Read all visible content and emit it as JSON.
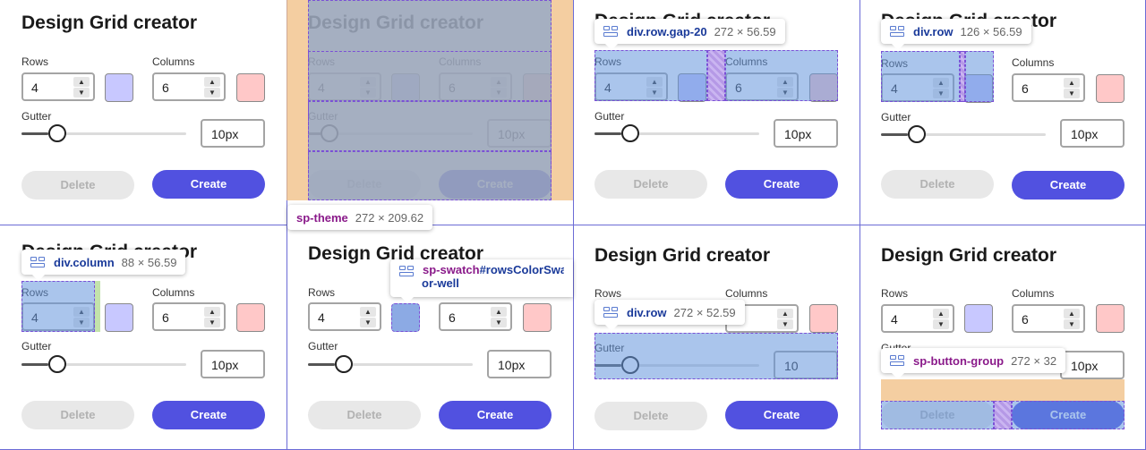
{
  "app": {
    "title": "Design Grid creator",
    "rows_label": "Rows",
    "columns_label": "Columns",
    "gutter_label": "Gutter",
    "rows_value": "4",
    "columns_value": "6",
    "gutter_value": "10px",
    "gutter_value_alt": "10",
    "delete_label": "Delete",
    "create_label": "Create",
    "rows_swatch_color": "#c8c8ff",
    "columns_swatch_color": "#ffc8c8"
  },
  "tooltips": {
    "p2": {
      "name": "sp-theme",
      "dims": "272 × 209.62"
    },
    "p3": {
      "name": "div.row.gap-20",
      "dims": "272 × 56.59"
    },
    "p4": {
      "name": "div.row",
      "dims": "126 × 56.59"
    },
    "p5": {
      "name": "div.column",
      "dims": "88 × 56.59"
    },
    "p6": {
      "name": "sp-swatch",
      "name_suffix": "#rowsColorSwatch",
      "line2": "or-well"
    },
    "p7": {
      "name": "div.row",
      "dims": "272 × 52.59"
    },
    "p8": {
      "name": "sp-button-group",
      "dims": "272 × 32"
    }
  }
}
